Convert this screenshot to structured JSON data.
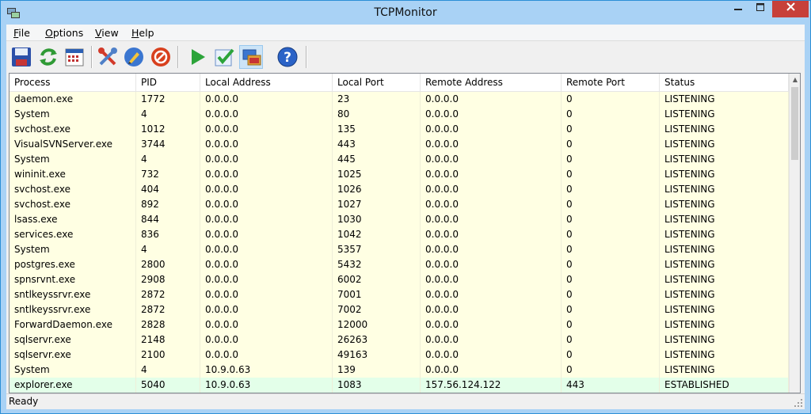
{
  "window": {
    "title": "TCPMonitor"
  },
  "menu": {
    "items": [
      {
        "label": "File",
        "hot": "F",
        "rest": "ile"
      },
      {
        "label": "Options",
        "hot": "O",
        "rest": "ptions"
      },
      {
        "label": "View",
        "hot": "V",
        "rest": "iew"
      },
      {
        "label": "Help",
        "hot": "H",
        "rest": "elp"
      }
    ]
  },
  "toolbar": {
    "buttons": [
      {
        "icon": "save-icon"
      },
      {
        "icon": "refresh-icon"
      },
      {
        "icon": "calendar-icon"
      },
      {
        "icon": "tools-icon"
      },
      {
        "icon": "edit-icon"
      },
      {
        "icon": "stop-icon"
      },
      {
        "icon": "play-icon"
      },
      {
        "icon": "checkmark-icon"
      },
      {
        "icon": "windows-icon"
      },
      {
        "icon": "help-icon"
      }
    ]
  },
  "table": {
    "columns": [
      "Process",
      "PID",
      "Local Address",
      "Local Port",
      "Remote Address",
      "Remote Port",
      "Status"
    ],
    "rows": [
      [
        "daemon.exe",
        "1772",
        "0.0.0.0",
        "23",
        "0.0.0.0",
        "0",
        "LISTENING"
      ],
      [
        "System",
        "4",
        "0.0.0.0",
        "80",
        "0.0.0.0",
        "0",
        "LISTENING"
      ],
      [
        "svchost.exe",
        "1012",
        "0.0.0.0",
        "135",
        "0.0.0.0",
        "0",
        "LISTENING"
      ],
      [
        "VisualSVNServer.exe",
        "3744",
        "0.0.0.0",
        "443",
        "0.0.0.0",
        "0",
        "LISTENING"
      ],
      [
        "System",
        "4",
        "0.0.0.0",
        "445",
        "0.0.0.0",
        "0",
        "LISTENING"
      ],
      [
        "wininit.exe",
        "732",
        "0.0.0.0",
        "1025",
        "0.0.0.0",
        "0",
        "LISTENING"
      ],
      [
        "svchost.exe",
        "404",
        "0.0.0.0",
        "1026",
        "0.0.0.0",
        "0",
        "LISTENING"
      ],
      [
        "svchost.exe",
        "892",
        "0.0.0.0",
        "1027",
        "0.0.0.0",
        "0",
        "LISTENING"
      ],
      [
        "lsass.exe",
        "844",
        "0.0.0.0",
        "1030",
        "0.0.0.0",
        "0",
        "LISTENING"
      ],
      [
        "services.exe",
        "836",
        "0.0.0.0",
        "1042",
        "0.0.0.0",
        "0",
        "LISTENING"
      ],
      [
        "System",
        "4",
        "0.0.0.0",
        "5357",
        "0.0.0.0",
        "0",
        "LISTENING"
      ],
      [
        "postgres.exe",
        "2800",
        "0.0.0.0",
        "5432",
        "0.0.0.0",
        "0",
        "LISTENING"
      ],
      [
        "spnsrvnt.exe",
        "2908",
        "0.0.0.0",
        "6002",
        "0.0.0.0",
        "0",
        "LISTENING"
      ],
      [
        "sntlkeyssrvr.exe",
        "2872",
        "0.0.0.0",
        "7001",
        "0.0.0.0",
        "0",
        "LISTENING"
      ],
      [
        "sntlkeyssrvr.exe",
        "2872",
        "0.0.0.0",
        "7002",
        "0.0.0.0",
        "0",
        "LISTENING"
      ],
      [
        "ForwardDaemon.exe",
        "2828",
        "0.0.0.0",
        "12000",
        "0.0.0.0",
        "0",
        "LISTENING"
      ],
      [
        "sqlservr.exe",
        "2148",
        "0.0.0.0",
        "26263",
        "0.0.0.0",
        "0",
        "LISTENING"
      ],
      [
        "sqlservr.exe",
        "2100",
        "0.0.0.0",
        "49163",
        "0.0.0.0",
        "0",
        "LISTENING"
      ],
      [
        "System",
        "4",
        "10.9.0.63",
        "139",
        "0.0.0.0",
        "0",
        "LISTENING"
      ],
      [
        "explorer.exe",
        "5040",
        "10.9.0.63",
        "1083",
        "157.56.124.122",
        "443",
        "ESTABLISHED"
      ]
    ]
  },
  "status": {
    "text": "Ready"
  },
  "colors": {
    "listening_row": "#ffffe3",
    "established_row": "#e3ffe9",
    "title_bar": "#a9d2f5"
  }
}
